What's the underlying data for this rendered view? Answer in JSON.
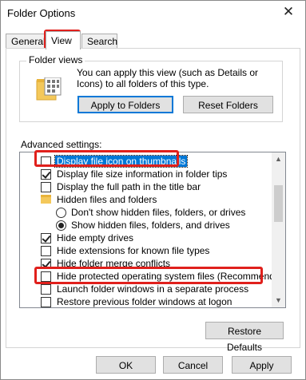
{
  "window": {
    "title": "Folder Options",
    "close_glyph": "✕"
  },
  "tabs": [
    {
      "label": "General"
    },
    {
      "label": "View",
      "active": true
    },
    {
      "label": "Search"
    }
  ],
  "folder_views": {
    "title": "Folder views",
    "text": "You can apply this view (such as Details or Icons) to all folders of this type.",
    "apply_button": "Apply to Folders",
    "reset_button": "Reset Folders"
  },
  "advanced": {
    "label": "Advanced settings:",
    "items": [
      {
        "label": "Display file icon on thumbnails",
        "control": "checkbox",
        "checked": false,
        "selected": true
      },
      {
        "label": "Display file size information in folder tips",
        "control": "checkbox",
        "checked": true
      },
      {
        "label": "Display the full path in the title bar",
        "control": "checkbox",
        "checked": false
      },
      {
        "label": "Hidden files and folders",
        "control": "folder"
      },
      {
        "label": "Don't show hidden files, folders, or drives",
        "control": "radio",
        "checked": false
      },
      {
        "label": "Show hidden files, folders, and drives",
        "control": "radio",
        "checked": true
      },
      {
        "label": "Hide empty drives",
        "control": "checkbox",
        "checked": true
      },
      {
        "label": "Hide extensions for known file types",
        "control": "checkbox",
        "checked": false
      },
      {
        "label": "Hide folder merge conflicts",
        "control": "checkbox",
        "checked": true
      },
      {
        "label": "Hide protected operating system files (Recommended)",
        "control": "checkbox",
        "checked": false
      },
      {
        "label": "Launch folder windows in a separate process",
        "control": "checkbox",
        "checked": false
      },
      {
        "label": "Restore previous folder windows at logon",
        "control": "checkbox",
        "checked": false
      }
    ],
    "restore_button": "Restore Defaults"
  },
  "footer": {
    "ok": "OK",
    "cancel": "Cancel",
    "apply": "Apply"
  },
  "colors": {
    "highlight": "#e0201c",
    "selection": "#0078d7"
  }
}
